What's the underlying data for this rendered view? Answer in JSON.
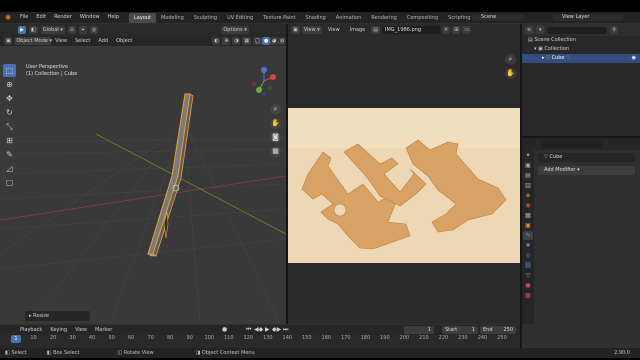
{
  "window": {
    "logo": "blender-logo",
    "menus": [
      "File",
      "Edit",
      "Render",
      "Window",
      "Help"
    ],
    "workspaces": [
      "Layout",
      "Modeling",
      "Sculpting",
      "UV Editing",
      "Texture Paint",
      "Shading",
      "Animation",
      "Rendering",
      "Compositing",
      "Scripting"
    ],
    "active_workspace": "Layout",
    "add_workspace": "+",
    "scene": "Scene",
    "view_layer": "View Layer"
  },
  "viewport": {
    "orientation_label": "Global",
    "mode": "Object Mode",
    "menus": [
      "View",
      "Select",
      "Add",
      "Object"
    ],
    "options": "Options",
    "info_line1": "User Perspective",
    "info_line2": "(1) Collection | Cube",
    "tools": [
      "select-box-icon",
      "cursor-icon",
      "move-icon",
      "rotate-icon",
      "scale-icon",
      "transform-icon",
      "annotate-icon",
      "measure-icon",
      "add-cube-icon"
    ],
    "gizmo_axes": [
      "X",
      "Y",
      "Z"
    ],
    "nav_buttons": [
      "zoom-icon",
      "hand-icon",
      "camera-icon",
      "grid-icon"
    ],
    "last_operator": "Resize"
  },
  "image_editor": {
    "menus": [
      "View",
      "View",
      "Image"
    ],
    "image_name": "IMG_1986.png"
  },
  "outliner": {
    "rows": [
      {
        "label": "Scene Collection",
        "indent": 0,
        "selected": false
      },
      {
        "label": "Collection",
        "indent": 1,
        "selected": false
      },
      {
        "label": "Cube",
        "indent": 2,
        "selected": true
      }
    ]
  },
  "properties": {
    "object_name": "Cube",
    "add_modifier": "Add Modifier",
    "tabs": [
      {
        "icon": "tool-icon",
        "color": "#b0b0b0"
      },
      {
        "icon": "render-icon",
        "color": "#b0b0b0"
      },
      {
        "icon": "output-icon",
        "color": "#b0b0b0"
      },
      {
        "icon": "view-layer-icon",
        "color": "#b0b0b0"
      },
      {
        "icon": "scene-icon",
        "color": "#c97d3a"
      },
      {
        "icon": "world-icon",
        "color": "#c84d4d"
      },
      {
        "icon": "collection-icon",
        "color": "#b0b0b0"
      },
      {
        "icon": "object-icon",
        "color": "#e3903a"
      },
      {
        "icon": "modifier-icon",
        "color": "#5a8ad6"
      },
      {
        "icon": "particles-icon",
        "color": "#5a8ad6"
      },
      {
        "icon": "physics-icon",
        "color": "#5a8ad6"
      },
      {
        "icon": "constraints-icon",
        "color": "#5a8ad6"
      },
      {
        "icon": "data-icon",
        "color": "#5ec25e"
      },
      {
        "icon": "material-icon",
        "color": "#c84d4d"
      },
      {
        "icon": "texture-icon",
        "color": "#c84d4d"
      }
    ]
  },
  "timeline": {
    "menus": [
      "Playback",
      "Keying",
      "View",
      "Marker"
    ],
    "current_frame": "1",
    "frame_field": "1",
    "start_label": "Start",
    "start": "1",
    "end_label": "End",
    "end": "250",
    "ticks": [
      "1",
      "10",
      "20",
      "30",
      "40",
      "50",
      "60",
      "70",
      "80",
      "90",
      "100",
      "110",
      "120",
      "130",
      "140",
      "150",
      "160",
      "170",
      "180",
      "190",
      "200",
      "210",
      "220",
      "230",
      "240",
      "250"
    ]
  },
  "statusbar": {
    "items": [
      "Select",
      "Box Select",
      "Rotate View",
      "Object Context Menu"
    ],
    "version": "2.90.0"
  }
}
